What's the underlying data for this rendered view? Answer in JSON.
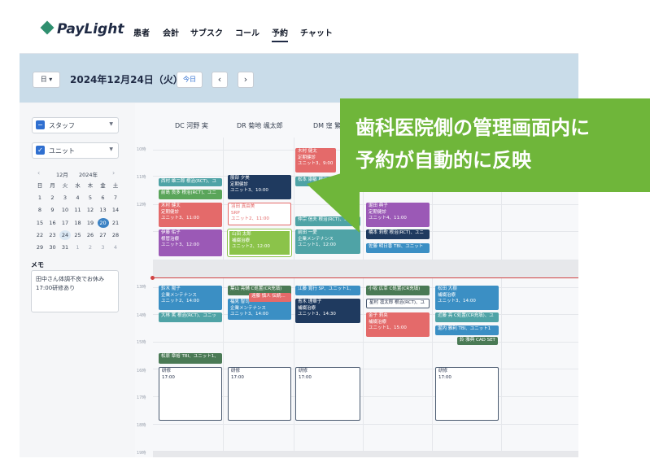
{
  "app": {
    "logo": "PayLight",
    "nav": [
      "患者",
      "会計",
      "サブスク",
      "コール",
      "予約",
      "チャット"
    ],
    "nav_active": "予約"
  },
  "datebar": {
    "view": "日",
    "date": "2024年12月24日（火）",
    "today": "今日",
    "prev": "‹",
    "next": "›"
  },
  "sidebar": {
    "staff_filter": "スタッフ",
    "unit_filter": "ユニット",
    "calendar": {
      "month": "12月",
      "year": "2024年",
      "weekdays": [
        "日",
        "月",
        "火",
        "水",
        "木",
        "金",
        "土"
      ],
      "weeks": [
        [
          "1",
          "2",
          "3",
          "4",
          "5",
          "6",
          "7"
        ],
        [
          "8",
          "9",
          "10",
          "11",
          "12",
          "13",
          "14"
        ],
        [
          "15",
          "16",
          "17",
          "18",
          "19",
          "20",
          "21"
        ],
        [
          "22",
          "23",
          "24",
          "25",
          "26",
          "27",
          "28"
        ],
        [
          "29",
          "30",
          "31",
          "1",
          "2",
          "3",
          "4"
        ]
      ],
      "selected": "20",
      "today": "24"
    },
    "memo_label": "メモ",
    "memo_lines": [
      "田中さん体調不良でお休み",
      "17:00研修あり"
    ]
  },
  "grid": {
    "columns": [
      "DC 河野 実",
      "DR 菊地 颯太郎",
      "DM 窪 繁"
    ],
    "times": [
      "10時",
      "11時",
      "12時",
      "13時",
      "14時",
      "15時",
      "16時",
      "17時",
      "18時",
      "19時"
    ],
    "events": {
      "e1": [
        "西村 雄二郎 根治(RCT)、ユ"
      ],
      "e2": [
        "前島 良多 根治(RCT)、ユニ"
      ],
      "e3": [
        "木村 健太",
        "定期健診",
        "ユニット3、11:00"
      ],
      "e4": [
        "伊藤 佑子",
        "根管治療",
        "ユニット3、12:00"
      ],
      "e5": [
        "鈴木 陽子",
        "企業メンテナンス",
        "ユニット2、14:00"
      ],
      "e6": [
        "大林 篤 根治(RCT)、ユニッ"
      ],
      "e7": [
        "松原 章裕 TBI、ユニット1、"
      ],
      "e8": [
        "研修",
        "17:00"
      ],
      "e9": [
        "服部 夕美",
        "定期健診",
        "ユニット3、10:00"
      ],
      "e10": [
        "羽田 真由美",
        "SRP",
        "ユニット2、11:00"
      ],
      "e11": [
        "山田 太郎",
        "補綴治療",
        "ユニット2、12:00"
      ],
      "e12": [
        "葉山 亮輔 C処置(CR充填)"
      ],
      "e13": [
        "福見 智司",
        "企業メンテナンス",
        "ユニット3、14:00"
      ],
      "e14": [
        "遠藤 慎人 伝統..."
      ],
      "e15": [
        "研修",
        "17:00"
      ],
      "e16": [
        "木村 健太",
        "定期健診",
        "ユニット3、9:00"
      ],
      "e17": [
        "松本 康敏 根治(RCT)"
      ],
      "e18": [
        "仲宗 信夫 根治(RCT)、ユ"
      ],
      "e19": [
        "前田 一愛",
        "企業メンテナンス",
        "ユニット1、12:00"
      ],
      "e20": [
        "江藤 寛行 SP、ユニット1、"
      ],
      "e21": [
        "青木 理華子",
        "補綴治療",
        "ユニット3、14:30"
      ],
      "e22": [
        "研修",
        "17:00"
      ],
      "e23": [
        "堀田 典子",
        "定期健診",
        "ユニット4、11:00"
      ],
      "e24": [
        "橋本 莉歌 根治(RCT)、ユニ"
      ],
      "e25": [
        "佐藤 明日香 TBI、ユニット"
      ],
      "e26": [
        "小坂 広幸 C処置(CR充填)"
      ],
      "e27": [
        "星村 凛太郎 根治(RCT)、ユ"
      ],
      "e28": [
        "金子 莉央",
        "補綴治療",
        "ユニット1、15:00"
      ],
      "e29": [
        "松田 大樹",
        "補綴治療",
        "ユニット3、14:00"
      ],
      "e30": [
        "近藤 亮 C処置(CR充填)、ユ"
      ],
      "e31": [
        "堀内 雅利 TBI、ユニット1"
      ],
      "e32": [
        "鈴 雅典 CAD SET"
      ],
      "e33": [
        "研修",
        "17:00"
      ]
    }
  },
  "callout": {
    "line1": "歯科医院側の管理画面内に",
    "line2": "予約が自動的に反映"
  }
}
